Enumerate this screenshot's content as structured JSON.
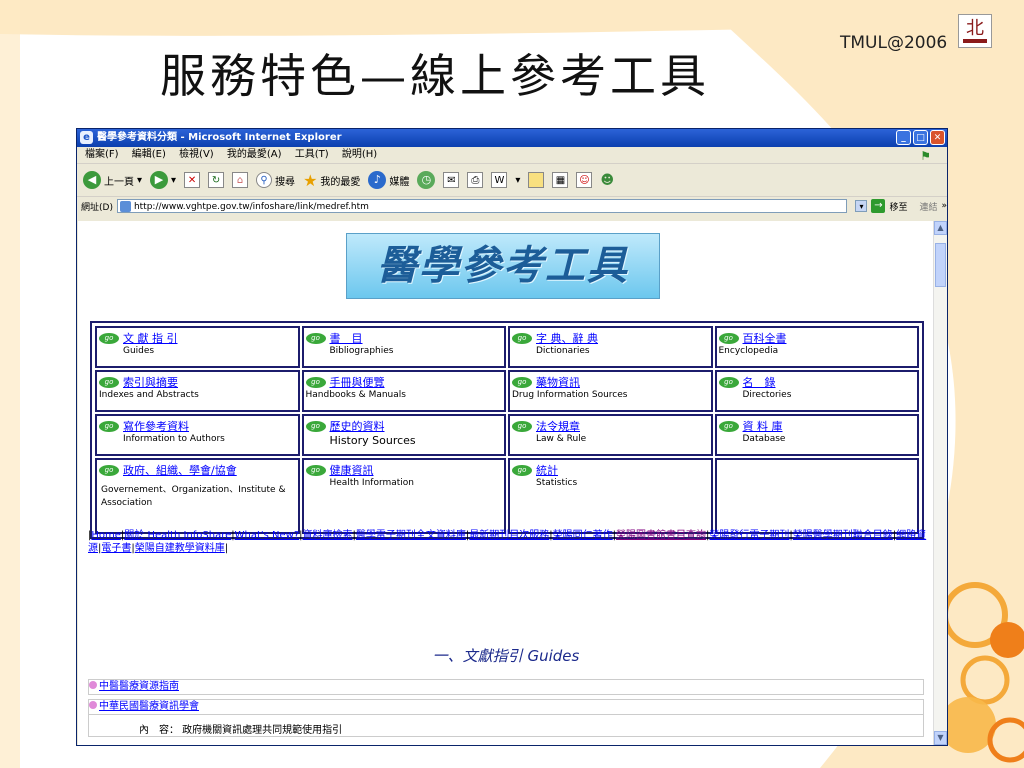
{
  "slide": {
    "title": "服務特色—線上參考工具",
    "brand": "TMUL@2006",
    "logo_symbol": "北"
  },
  "browser": {
    "window_title": "醫學參考資料分類 - Microsoft Internet Explorer",
    "menu": [
      "檔案(F)",
      "編輯(E)",
      "檢視(V)",
      "我的最愛(A)",
      "工具(T)",
      "說明(H)"
    ],
    "toolbar": {
      "back": "上一頁",
      "search": "搜尋",
      "favorites": "我的最愛",
      "media": "媒體"
    },
    "address_label": "網址(D)",
    "address_url": "http://www.vghtpe.gov.tw/infoshare/link/medref.htm",
    "go_label": "移至",
    "links_label": "連結",
    "accent": "#0b3fae"
  },
  "page": {
    "banner": "醫學參考工具",
    "categories": [
      {
        "title": "文 獻 指 引",
        "sub": "Guides"
      },
      {
        "title": "書　目",
        "sub": "Bibliographies"
      },
      {
        "title": "字 典、辭 典",
        "sub": "Dictionaries"
      },
      {
        "title": "百科全書",
        "sub": "Encyclopedia"
      },
      {
        "title": "索引與摘要",
        "sub": "Indexes and Abstracts"
      },
      {
        "title": "手冊與便覽",
        "sub": "Handbooks & Manuals"
      },
      {
        "title": "藥物資訊",
        "sub": "Drug Information Sources"
      },
      {
        "title": "名　錄",
        "sub": "Directories"
      },
      {
        "title": "寫作參考資料",
        "sub": "Information to Authors"
      },
      {
        "title": "歷史的資料",
        "sub": "History Sources"
      },
      {
        "title": "法令規章",
        "sub": "Law & Rule"
      },
      {
        "title": "資 料 庫",
        "sub": "Database"
      },
      {
        "title": "政府、組織、學會/協會",
        "sub": "Governement、Organization、Institute & Association"
      },
      {
        "title": "健康資訊",
        "sub": "Health Information"
      },
      {
        "title": "統計",
        "sub": "Statistics"
      }
    ],
    "nav_links": [
      "Home",
      "關於 Health InfoShare",
      "What's New?",
      "資料庫檢索",
      "醫學電子期刊全文資料庫",
      "最新期刊目次服務",
      "榮陽同仁著作",
      "榮陽圖書館書目查詢",
      "榮陽發行電子期刊",
      "榮陽醫學期刊聯合目錄",
      "網路資源",
      "電子書",
      "榮陽自建教學資料庫"
    ],
    "section_heading": "一、文獻指引 Guides",
    "list_items": [
      "中醫醫療資源指南",
      "中華民國醫療資訊學會"
    ],
    "list_content": "內　容：  政府機關資訊處理共同規範使用指引"
  }
}
